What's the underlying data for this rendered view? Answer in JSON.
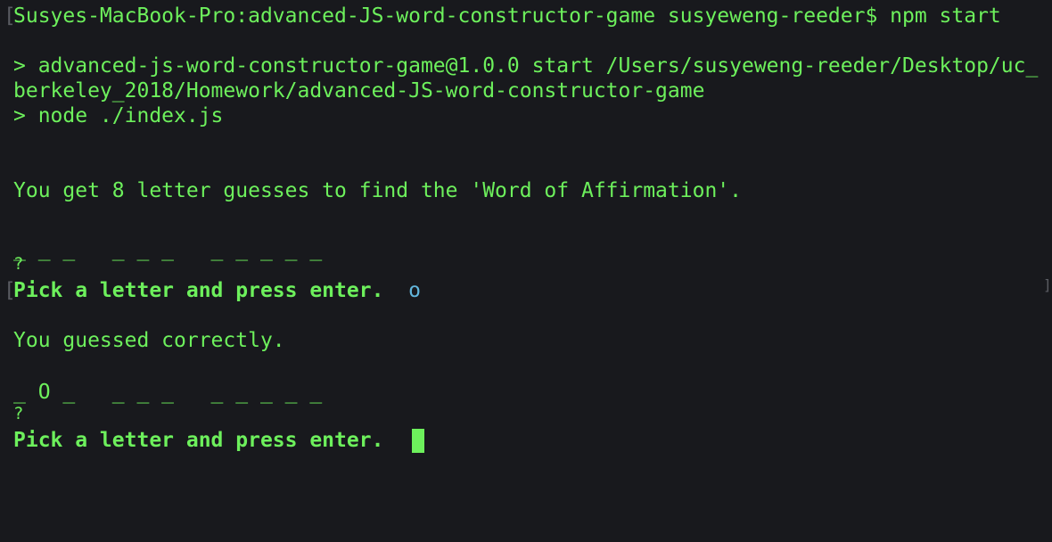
{
  "terminal": {
    "prompt_command": "Susyes-MacBook-Pro:advanced-JS-word-constructor-game susyeweng-reeder$ npm start",
    "npm_script_line1": "> advanced-js-word-constructor-game@1.0.0 start /Users/susyeweng-reeder/Desktop/uc_",
    "npm_script_line2": "berkeley_2018/Homework/advanced-JS-word-constructor-game",
    "npm_script_line3": "> node ./index.js",
    "intro": "You get 8 letter guesses to find the 'Word of Affirmation'.",
    "word_display_1": "_ _ _   _ _ _   _ _ _ _ _",
    "question_mark_1": "?",
    "prompt_label_1": "Pick a letter and press enter.",
    "typed_input_1": "o",
    "feedback": "You guessed correctly.",
    "word_display_2": "_ O _   _ _ _   _ _ _ _ _",
    "question_mark_2": "?",
    "prompt_label_2": "Pick a letter and press enter."
  },
  "colors": {
    "background": "#18191d",
    "text": "#6df05c",
    "typed_input": "#62b6dc",
    "mark": "#5a5c62"
  }
}
